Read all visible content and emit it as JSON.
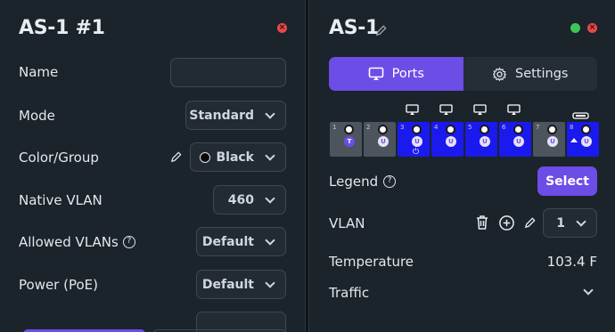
{
  "left_panel": {
    "title": "AS-1 #1",
    "rows": [
      {
        "label": "Name",
        "value": ""
      },
      {
        "label": "Mode",
        "value": "Standard"
      },
      {
        "label": "Color/Group",
        "value": "Black"
      },
      {
        "label": "Native VLAN",
        "value": "460"
      },
      {
        "label": "Allowed VLANs",
        "value": "Default"
      },
      {
        "label": "Power (PoE)",
        "value": "Default"
      }
    ]
  },
  "right_panel": {
    "title": "AS-1",
    "tabs": [
      {
        "label": "Ports",
        "active": true
      },
      {
        "label": "Settings",
        "active": false
      }
    ],
    "ports": [
      {
        "num": "1",
        "badge": "T",
        "state": "inactive"
      },
      {
        "num": "2",
        "badge": "U",
        "state": "inactive"
      },
      {
        "num": "3",
        "badge": "U",
        "state": "active"
      },
      {
        "num": "4",
        "badge": "U",
        "state": "active"
      },
      {
        "num": "5",
        "badge": "U",
        "state": "active"
      },
      {
        "num": "6",
        "badge": "U",
        "state": "active"
      },
      {
        "num": "7",
        "badge": "U",
        "state": "inactive"
      },
      {
        "num": "8",
        "badge": "U",
        "state": "active"
      }
    ],
    "legend_label": "Legend",
    "select_label": "Select",
    "vlan_label": "VLAN",
    "vlan_value": "1",
    "temperature_label": "Temperature",
    "temperature_value": "103.4 F",
    "traffic_label": "Traffic"
  },
  "colors": {
    "accent": "#6c4de6",
    "port_active": "#1a1aee",
    "port_inactive": "#4c545e",
    "close": "#e8494b",
    "ok": "#3ec55a"
  }
}
